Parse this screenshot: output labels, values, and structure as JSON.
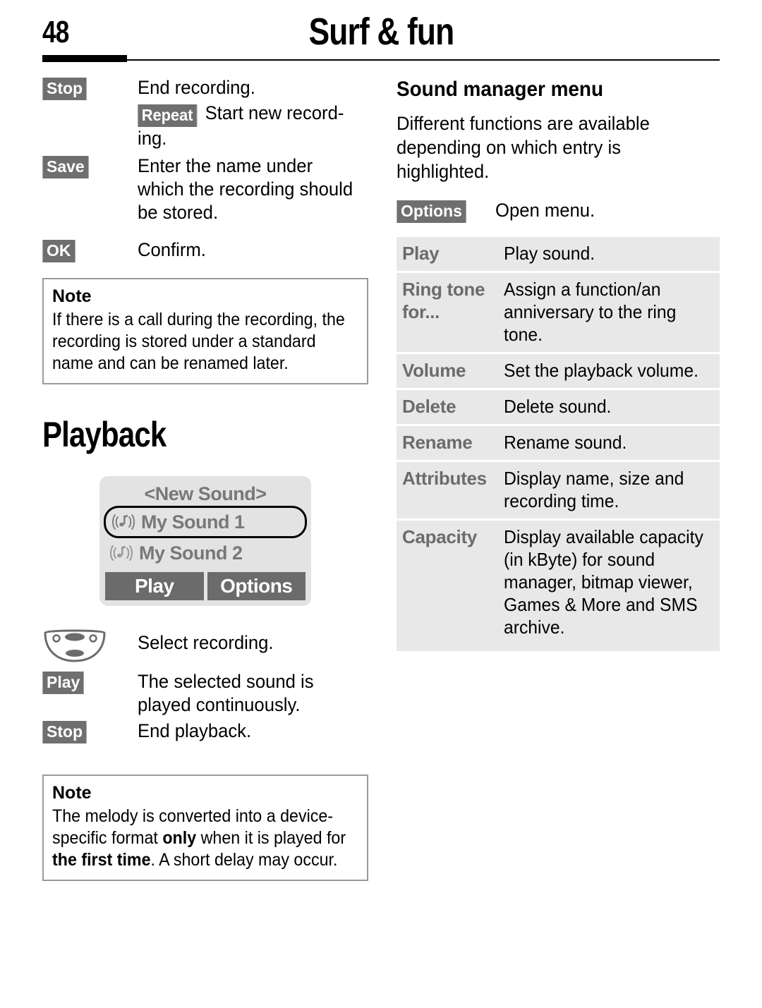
{
  "header": {
    "page_number": "48",
    "chapter_title": "Surf & fun"
  },
  "left_column": {
    "steps_recording": [
      {
        "key": "Stop",
        "description": "End recording."
      },
      {
        "key": "",
        "inline_key": "Repeat",
        "description": "Start new record-\ning."
      },
      {
        "key": "Save",
        "description": "Enter the name under which the recording should be stored."
      },
      {
        "key": "OK",
        "description": "Confirm."
      }
    ],
    "note_1": {
      "title": "Note",
      "body": "If there is a call during the recording, the recording is stored under a standard name and can be renamed later."
    },
    "playback_heading": "Playback",
    "phone_screen": {
      "title": "<New Sound>",
      "items": [
        {
          "label": "My Sound 1",
          "icon": "sound-note-icon",
          "selected": true
        },
        {
          "label": "My Sound 2",
          "icon": "sound-note-icon",
          "selected": false
        }
      ],
      "softkeys": [
        {
          "label": "Play"
        },
        {
          "label": "Options"
        }
      ]
    },
    "steps_playback": [
      {
        "key": "nav-key-icon",
        "is_icon": true,
        "description": "Select recording."
      },
      {
        "key": "Play",
        "description": "The selected sound is played continuously."
      },
      {
        "key": "Stop",
        "description": "End playback."
      }
    ],
    "note_2": {
      "title": "Note",
      "body_part_1": "The melody is converted into a device-specific format ",
      "body_bold_1": "only",
      "body_part_2": " when it is played for ",
      "body_bold_2": "the first time",
      "body_part_3": ". A short delay may occur."
    }
  },
  "right_column": {
    "heading": "Sound manager menu",
    "intro": "Different functions are available depending on which entry is highlighted.",
    "options_step": {
      "key": "Options",
      "description": "Open menu."
    },
    "menu_table": [
      {
        "term": "Play",
        "definition": "Play sound."
      },
      {
        "term": "Ring tone for...",
        "definition": "Assign a function/an anniversary to the ring tone."
      },
      {
        "term": "Volume",
        "definition": "Set the playback volume."
      },
      {
        "term": "Delete",
        "definition": "Delete sound."
      },
      {
        "term": "Rename",
        "definition": "Rename sound."
      },
      {
        "term": "Attributes",
        "definition": "Display name, size and recording time."
      },
      {
        "term": "Capacity",
        "definition": "Display available capacity (in kByte) for sound manager, bitmap viewer, Games & More and SMS archive."
      }
    ]
  },
  "colors": {
    "softkey_bg": "#6f6f6f",
    "screen_bg": "#e3e3e3",
    "table_row_bg": "#e8e8e8",
    "term_text": "#6b6b6b",
    "note_border": "#9a9a9a"
  }
}
